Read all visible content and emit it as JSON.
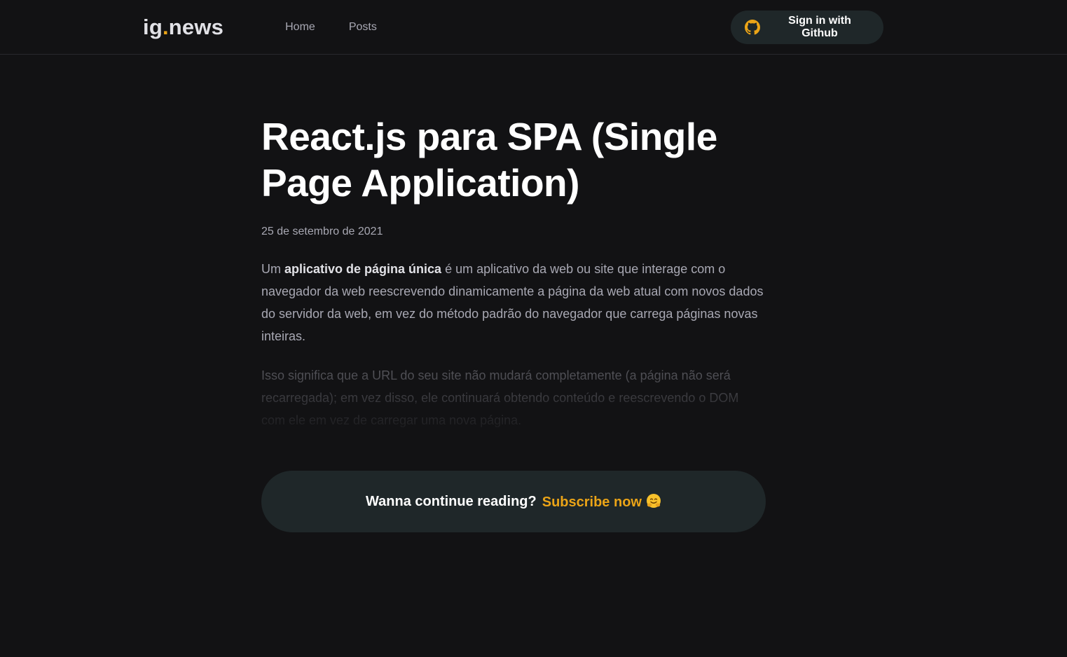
{
  "header": {
    "logo_text": "ig",
    "logo_dot": ".",
    "logo_suffix": "news",
    "nav": [
      {
        "label": "Home"
      },
      {
        "label": "Posts"
      }
    ],
    "signin_label": "Sign in with Github",
    "signin_icon": "github-icon"
  },
  "post": {
    "title": "React.js para SPA (Single Page Application)",
    "date": "25 de setembro de 2021",
    "p1_pre": "Um ",
    "p1_bold": "aplicativo de página única",
    "p1_post": " é um aplicativo da web ou site que interage com o navegador da web reescrevendo dinamicamente a página da web atual com novos dados do servidor da web, em vez do método padrão do navegador que carrega páginas novas inteiras.",
    "p2": "Isso significa que a URL do seu site não mudará completamente (a página não será recarregada); em vez disso, ele continuará obtendo conteúdo e reescrevendo o DOM com ele em vez de carregar uma nova página."
  },
  "cta": {
    "text": "Wanna continue reading?",
    "link_label": "Subscribe now",
    "emoji": "hugging-face-emoji"
  },
  "colors": {
    "background": "#121214",
    "accent": "#eba417",
    "button_bg": "#1f2729",
    "text_muted": "#a8a8b3"
  }
}
